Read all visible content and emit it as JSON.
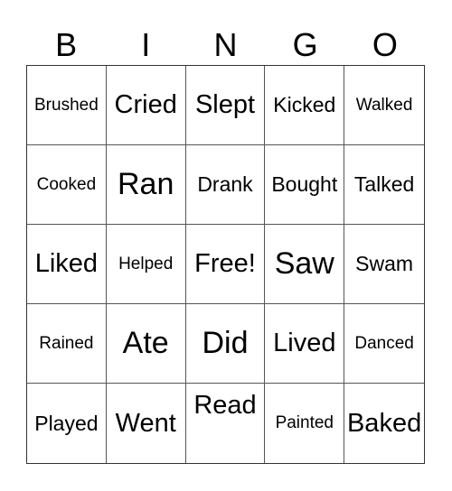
{
  "header": {
    "letters": [
      "B",
      "I",
      "N",
      "G",
      "O"
    ]
  },
  "cells": [
    [
      "Brushed",
      "Cried",
      "Slept",
      "Kicked",
      "Walked"
    ],
    [
      "Cooked",
      "Ran",
      "Drank",
      "Bought",
      "Talked"
    ],
    [
      "Liked",
      "Helped",
      "Free!",
      "Saw",
      "Swam"
    ],
    [
      "Rained",
      "Ate",
      "Did",
      "Lived",
      "Danced"
    ],
    [
      "Played",
      "Went",
      "Read",
      "Painted",
      "Baked"
    ]
  ]
}
